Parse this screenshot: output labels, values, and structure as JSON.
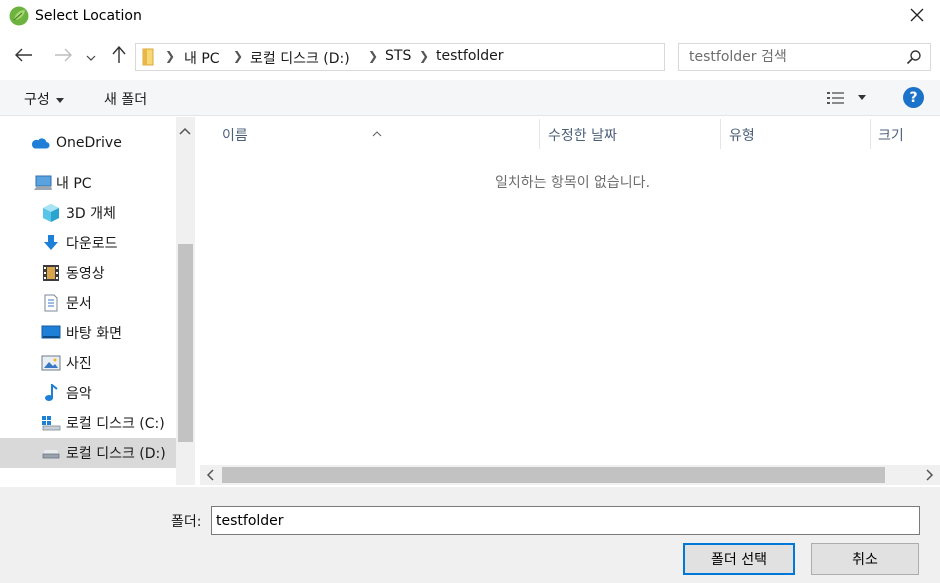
{
  "window": {
    "title": "Select Location"
  },
  "nav": {
    "crumbs": [
      "내 PC",
      "로컬 디스크 (D:)",
      "STS",
      "testfolder"
    ],
    "icons": {
      "back": "arrow-left-icon",
      "forward": "arrow-right-icon",
      "recent": "chevron-down-icon",
      "up": "arrow-up-icon",
      "refresh": "refresh-icon"
    }
  },
  "search": {
    "placeholder": "testfolder 검색"
  },
  "toolbar": {
    "organize_label": "구성",
    "new_folder_label": "새 폴더"
  },
  "sidebar": {
    "items": [
      {
        "label": "OneDrive",
        "icon": "cloud-icon"
      },
      {
        "label": "내 PC",
        "icon": "computer-icon"
      },
      {
        "label": "3D 개체",
        "icon": "cube-icon"
      },
      {
        "label": "다운로드",
        "icon": "download-icon"
      },
      {
        "label": "동영상",
        "icon": "film-icon"
      },
      {
        "label": "문서",
        "icon": "document-icon"
      },
      {
        "label": "바탕 화면",
        "icon": "desktop-icon"
      },
      {
        "label": "사진",
        "icon": "picture-icon"
      },
      {
        "label": "음악",
        "icon": "music-icon"
      },
      {
        "label": "로컬 디스크 (C:)",
        "icon": "windows-drive-icon"
      },
      {
        "label": "로컬 디스크 (D:)",
        "icon": "drive-icon",
        "selected": true
      }
    ]
  },
  "filelist": {
    "columns": [
      "이름",
      "수정한 날짜",
      "유형",
      "크기"
    ],
    "empty_message": "일치하는 항목이 없습니다."
  },
  "footer": {
    "folder_label": "폴더:",
    "folder_value": "testfolder",
    "select_button": "폴더 선택",
    "cancel_button": "취소"
  },
  "colors": {
    "accent": "#0078d7",
    "help": "#1a73c8",
    "selected_row": "#d9d9d9"
  }
}
